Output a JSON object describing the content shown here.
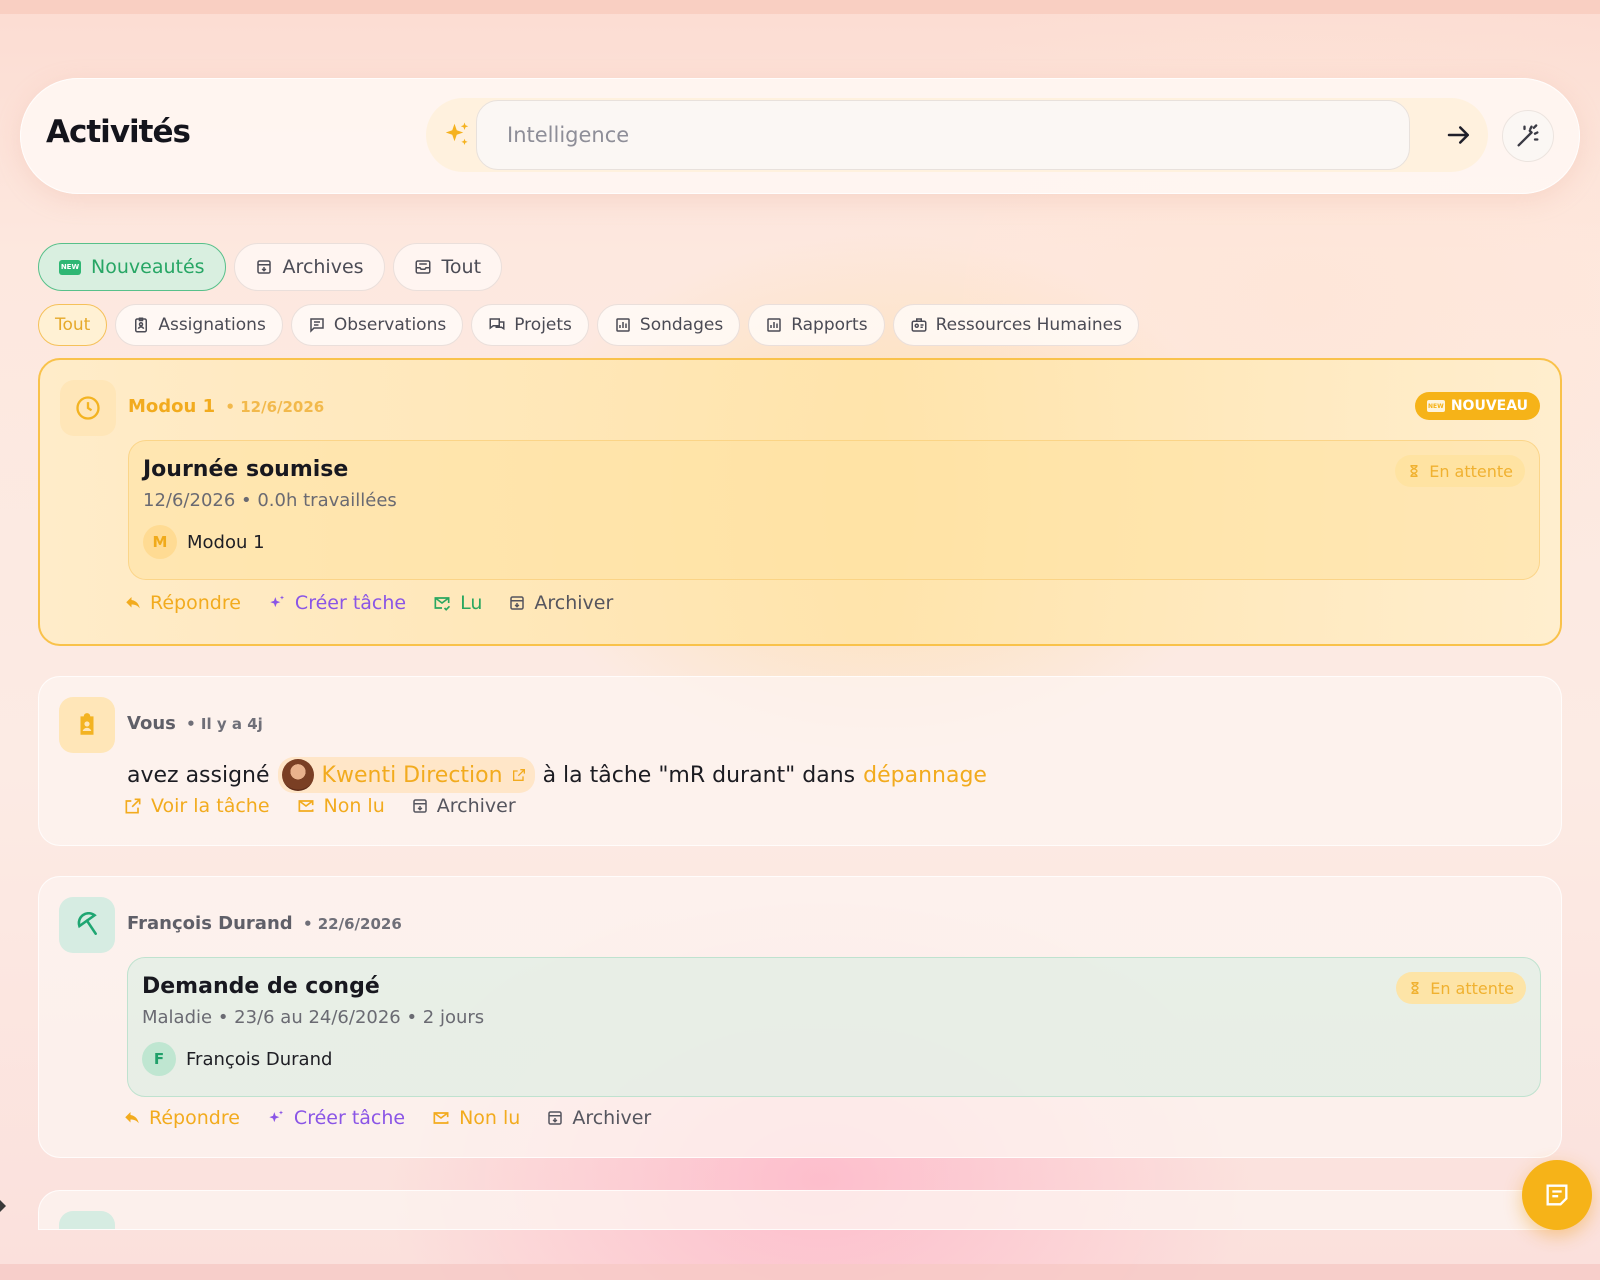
{
  "header": {
    "title": "Activités",
    "ai_placeholder": "Intelligence"
  },
  "tabs": {
    "main": [
      {
        "label": "Nouveautés",
        "icon": "new-icon",
        "active": true
      },
      {
        "label": "Archives",
        "icon": "archive-icon"
      },
      {
        "label": "Tout",
        "icon": "inbox-icon"
      }
    ],
    "filters": [
      {
        "label": "Tout",
        "active": true
      },
      {
        "label": "Assignations",
        "icon": "badge-icon"
      },
      {
        "label": "Observations",
        "icon": "message-icon"
      },
      {
        "label": "Projets",
        "icon": "chat-icon"
      },
      {
        "label": "Sondages",
        "icon": "bar-chart-icon"
      },
      {
        "label": "Rapports",
        "icon": "bar-chart-icon"
      },
      {
        "label": "Ressources Humaines",
        "icon": "hr-icon"
      }
    ]
  },
  "cards": [
    {
      "author": "Modou 1",
      "date": "• 12/6/2026",
      "badge": "NOUVEAU",
      "badge_icon_text": "NEW",
      "icon": "clock-icon",
      "title": "Journée soumise",
      "subtitle": "12/6/2026 • 0.0h travaillées",
      "person_initial": "M",
      "person_name": "Modou 1",
      "status": "En attente",
      "actions": [
        "Répondre",
        "Créer tâche",
        "Lu",
        "Archiver"
      ]
    },
    {
      "author": "Vous",
      "date": "• Il y a 4j",
      "icon": "assignment-icon",
      "text_before": "avez assigné",
      "mention": "Kwenti Direction",
      "text_after": "à la tâche \"mR durant\" dans",
      "project": "dépannage",
      "actions": [
        "Voir la tâche",
        "Non lu",
        "Archiver"
      ]
    },
    {
      "author": "François Durand",
      "date": "• 22/6/2026",
      "icon": "umbrella-icon",
      "title": "Demande de congé",
      "subtitle": "Maladie • 23/6 au 24/6/2026 • 2 jours",
      "person_initial": "F",
      "person_name": "François Durand",
      "status": "En attente",
      "actions": [
        "Répondre",
        "Créer tâche",
        "Non lu",
        "Archiver"
      ]
    }
  ],
  "colors": {
    "accent_yellow": "#f6b318",
    "accent_green": "#2fb774",
    "accent_purple": "#8a55e6"
  }
}
